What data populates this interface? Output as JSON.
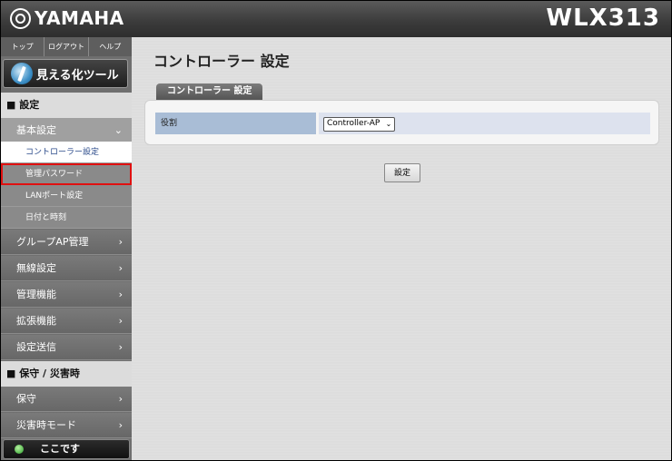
{
  "header": {
    "brand": "YAMAHA",
    "model": "WLX313"
  },
  "sidebar": {
    "top_links": [
      "トップ",
      "ログアウト",
      "ヘルプ"
    ],
    "viz_tool_label": "見える化ツール",
    "section_settings": "■ 設定",
    "basic_settings": "基本設定",
    "sub_items": [
      "コントローラー設定",
      "管理パスワード",
      "LANポート設定",
      "日付と時刻"
    ],
    "menu_items": [
      "グループAP管理",
      "無線設定",
      "管理機能",
      "拡張機能",
      "設定送信"
    ],
    "section_maintenance": "■ 保守 / 災害時",
    "maintenance_items": [
      "保守",
      "災害時モード"
    ],
    "here_label": "ここです"
  },
  "main": {
    "title": "コントローラー 設定",
    "tab_label": "コントローラー 設定",
    "role_label": "役割",
    "role_value": "Controller-AP",
    "submit_label": "設定"
  },
  "colors": {
    "highlight": "#e01010",
    "active_text": "#2a4a8a",
    "label_bg": "#a9bdd6"
  }
}
